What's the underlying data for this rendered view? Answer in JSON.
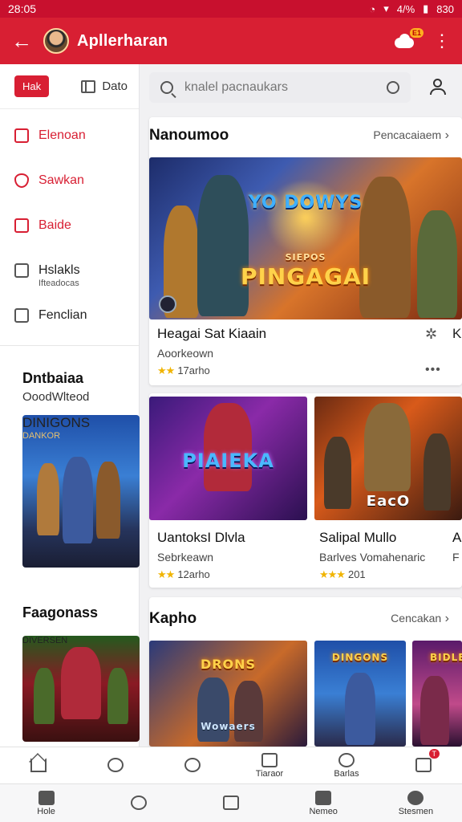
{
  "status": {
    "time": "28:05",
    "battery": "4/%",
    "clock_right": "830"
  },
  "appbar": {
    "title": "Apllerharan",
    "badge": "E1"
  },
  "sidebar": {
    "pill": "Hak",
    "toggle_label": "Dato",
    "items": [
      {
        "label": "Elenoan",
        "sub": ""
      },
      {
        "label": "Sawkan",
        "sub": ""
      },
      {
        "label": "Baide",
        "sub": ""
      },
      {
        "label": "Hslakls",
        "sub": "Ifteadocas"
      },
      {
        "label": "Fenclian",
        "sub": ""
      }
    ],
    "section1": {
      "title": "Dntbaiaa",
      "sub": "OoodWlteod",
      "art_logo": "DINIGONS",
      "art_caption": "DANKOR"
    },
    "section2": {
      "title": "Faagonass",
      "art_logo": "DIVERSEN"
    }
  },
  "search": {
    "placeholder": "knalel pacnaukars"
  },
  "section_top": {
    "title": "Nanoumoo",
    "more": "Pencacaiaem",
    "featured": {
      "logo_top": "YO DOWYS",
      "logo_bottom": "PINGAGAI",
      "logo_small": "SIEPOS",
      "title": "Heagai Sat Kiaain",
      "sub": "Aoorkeown",
      "rating": "17arho",
      "side_title": "K"
    },
    "row": [
      {
        "logo": "PIAIEKA",
        "title": "UantoksI Dlvla",
        "sub": "Sebrkeawn",
        "rating": "12arho"
      },
      {
        "logo": "EacO",
        "title": "Salipal Mullo",
        "sub": "Barlves Vomahenaric",
        "rating": "201"
      },
      {
        "title": "A",
        "sub": "F"
      }
    ]
  },
  "section_bottom": {
    "title": "Kapho",
    "more": "Cencakan",
    "tiles": [
      {
        "logo": "DRONS",
        "caption": "Wowaers"
      },
      {
        "logo": "DINGONS"
      },
      {
        "logo": "BIDLE"
      }
    ]
  },
  "bottom_nav_1": [
    {
      "label": ""
    },
    {
      "label": ""
    },
    {
      "label": ""
    },
    {
      "label": "Tiaraor"
    },
    {
      "label": "Barlas"
    },
    {
      "label": "",
      "badge": "T"
    }
  ],
  "bottom_nav_2": [
    {
      "label": "Hole"
    },
    {
      "label": ""
    },
    {
      "label": ""
    },
    {
      "label": "Nemeo"
    },
    {
      "label": "Stesmen"
    }
  ],
  "colors": {
    "primary": "#d81f33",
    "star": "#f0b400"
  }
}
